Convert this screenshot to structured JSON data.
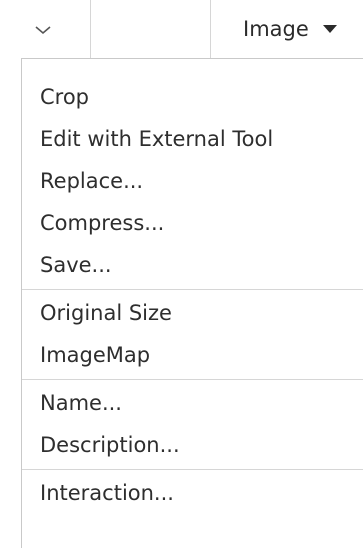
{
  "toolbar": {
    "dropdown_label": "Image"
  },
  "menu": {
    "items": [
      {
        "label": "Crop"
      },
      {
        "label": "Edit with External Tool"
      },
      {
        "label": "Replace..."
      },
      {
        "label": "Compress..."
      },
      {
        "label": "Save..."
      },
      {
        "label": "Original Size"
      },
      {
        "label": "ImageMap"
      },
      {
        "label": "Name..."
      },
      {
        "label": "Description..."
      },
      {
        "label": "Interaction..."
      }
    ]
  },
  "icons": {
    "toolbar_chevron": "chevron-down-icon",
    "dropdown_caret": "caret-down-icon"
  }
}
